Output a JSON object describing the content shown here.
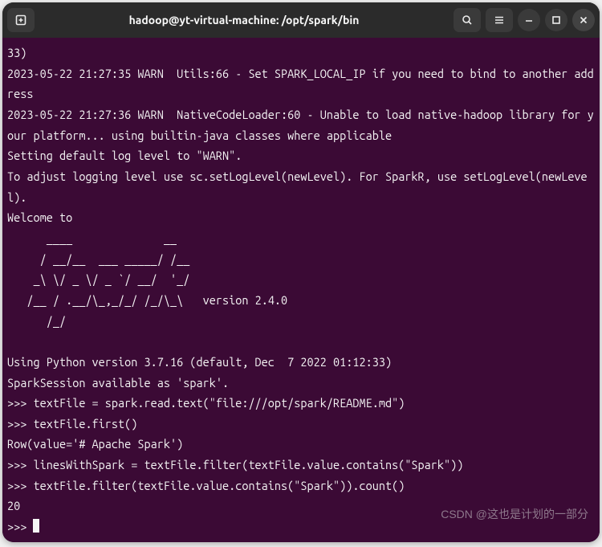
{
  "titlebar": {
    "title": "hadoop@yt-virtual-machine: /opt/spark/bin"
  },
  "terminal": {
    "lines": [
      "33)",
      "2023-05-22 21:27:35 WARN  Utils:66 - Set SPARK_LOCAL_IP if you need to bind to another address",
      "2023-05-22 21:27:36 WARN  NativeCodeLoader:60 - Unable to load native-hadoop library for your platform... using builtin-java classes where applicable",
      "Setting default log level to \"WARN\".",
      "To adjust logging level use sc.setLogLevel(newLevel). For SparkR, use setLogLevel(newLevel).",
      "Welcome to",
      "      ____              __",
      "     / __/__  ___ _____/ /__",
      "    _\\ \\/ _ \\/ _ `/ __/  '_/",
      "   /__ / .__/\\_,_/_/ /_/\\_\\   version 2.4.0",
      "      /_/",
      "",
      "Using Python version 3.7.16 (default, Dec  7 2022 01:12:33)",
      "SparkSession available as 'spark'.",
      ">>> textFile = spark.read.text(\"file:///opt/spark/README.md\")",
      ">>> textFile.first()",
      "Row(value='# Apache Spark')",
      ">>> linesWithSpark = textFile.filter(textFile.value.contains(\"Spark\"))",
      ">>> textFile.filter(textFile.value.contains(\"Spark\")).count()",
      "20",
      ">>> "
    ]
  },
  "watermark": "CSDN @这也是计划的一部分"
}
